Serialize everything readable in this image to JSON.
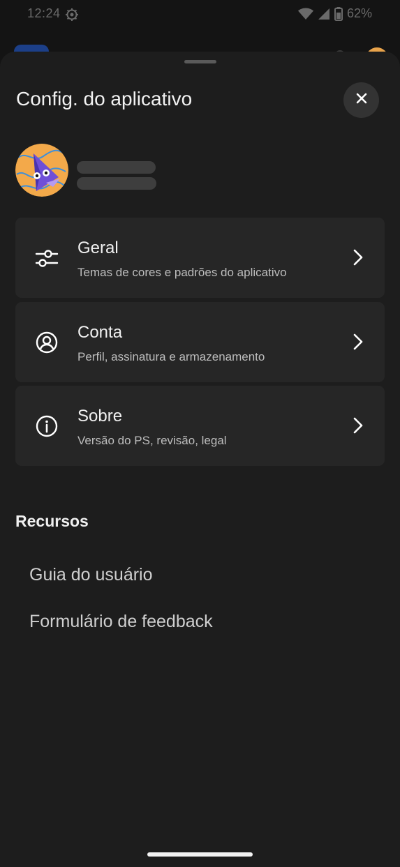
{
  "status_bar": {
    "time": "12:24",
    "battery": "62%",
    "icons": [
      "settings-gear-icon",
      "wifi-icon",
      "cellular-signal-icon",
      "battery-icon"
    ]
  },
  "sheet": {
    "title": "Config. do aplicativo",
    "close_icon": "close-icon"
  },
  "profile": {
    "avatar_icon": "profile-avatar-illustration",
    "name_hidden": true
  },
  "settings": [
    {
      "icon": "sliders-icon",
      "title": "Geral",
      "subtitle": "Temas de cores e padrões do aplicativo"
    },
    {
      "icon": "user-circle-icon",
      "title": "Conta",
      "subtitle": "Perfil, assinatura e armazenamento"
    },
    {
      "icon": "info-icon",
      "title": "Sobre",
      "subtitle": "Versão do PS, revisão, legal"
    }
  ],
  "resources": {
    "heading": "Recursos",
    "links": [
      "Guia do usuário",
      "Formulário de feedback"
    ]
  },
  "colors": {
    "background": "#141414",
    "sheet": "#1d1d1d",
    "card": "#262626",
    "text_primary": "#f0f0f0",
    "text_secondary": "#bdbdbd"
  }
}
